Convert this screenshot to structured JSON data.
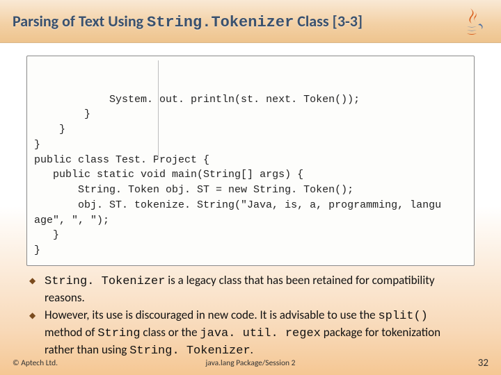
{
  "title": {
    "pre": "Parsing of Text Using ",
    "mono": "String.Tokenizer",
    "post": " Class [3-3]"
  },
  "code": {
    "l1": "            System. out. println(st. next. Token());",
    "l2": "        }",
    "l3": "    }",
    "l4": "}",
    "l5": "public class Test. Project {",
    "l6": "   public static void main(String[] args) {",
    "l7": "       String. Token obj. ST = new String. Token();",
    "l8": "       obj. ST. tokenize. String(\"Java, is, a, programming, langu",
    "l9": "age\", \", \");",
    "l10": "   }",
    "l11": "}"
  },
  "bullets": {
    "b1": {
      "p1": "String. Tokenizer",
      "p2": " is a legacy class that has been retained for compatibility reasons."
    },
    "b2": {
      "p1": "However, its use is discouraged in new code. It is advisable to use the ",
      "p2": "split() ",
      "p3": " method of ",
      "p4": "String",
      "p5": " class or the ",
      "p6": "java. util. regex",
      "p7": " package for tokenization rather than using ",
      "p8": "String. Tokenizer",
      "p9": "."
    }
  },
  "footer": {
    "left": "© Aptech Ltd.",
    "center": "java.lang Package/Session 2",
    "right": "32"
  }
}
